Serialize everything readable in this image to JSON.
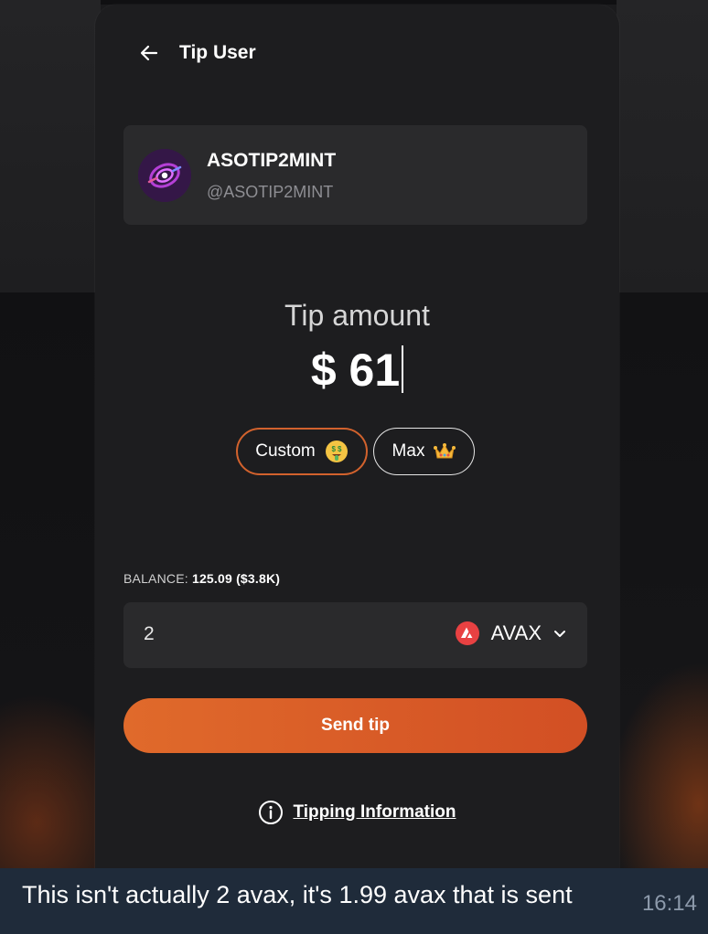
{
  "header": {
    "title": "Tip User",
    "back_icon": "arrow-left-icon"
  },
  "user": {
    "name": "ASOTIP2MINT",
    "handle": "@ASOTIP2MINT",
    "avatar_icon": "swirl-avatar"
  },
  "tip": {
    "label": "Tip amount",
    "amount": "$ 61"
  },
  "presets": {
    "custom_label": "Custom",
    "custom_emoji": "money-face-emoji",
    "max_label": "Max",
    "max_emoji": "crown-emoji"
  },
  "balance": {
    "label": "BALANCE:",
    "value": "125.09 ($3.8K)"
  },
  "amount_input": {
    "value": "2",
    "token": "AVAX",
    "token_icon": "avax-logo-icon",
    "dropdown_icon": "chevron-down-icon"
  },
  "send_button": {
    "label": "Send tip"
  },
  "info": {
    "label": "Tipping Information",
    "icon": "info-circle-icon"
  },
  "caption": {
    "text": "This isn't actually 2 avax, it's 1.99 avax that is sent",
    "time": "16:14"
  },
  "colors": {
    "accent": "#d9582a",
    "card_bg": "#2a2a2c",
    "modal_bg": "#1d1d1f",
    "avax_red": "#e84142"
  }
}
